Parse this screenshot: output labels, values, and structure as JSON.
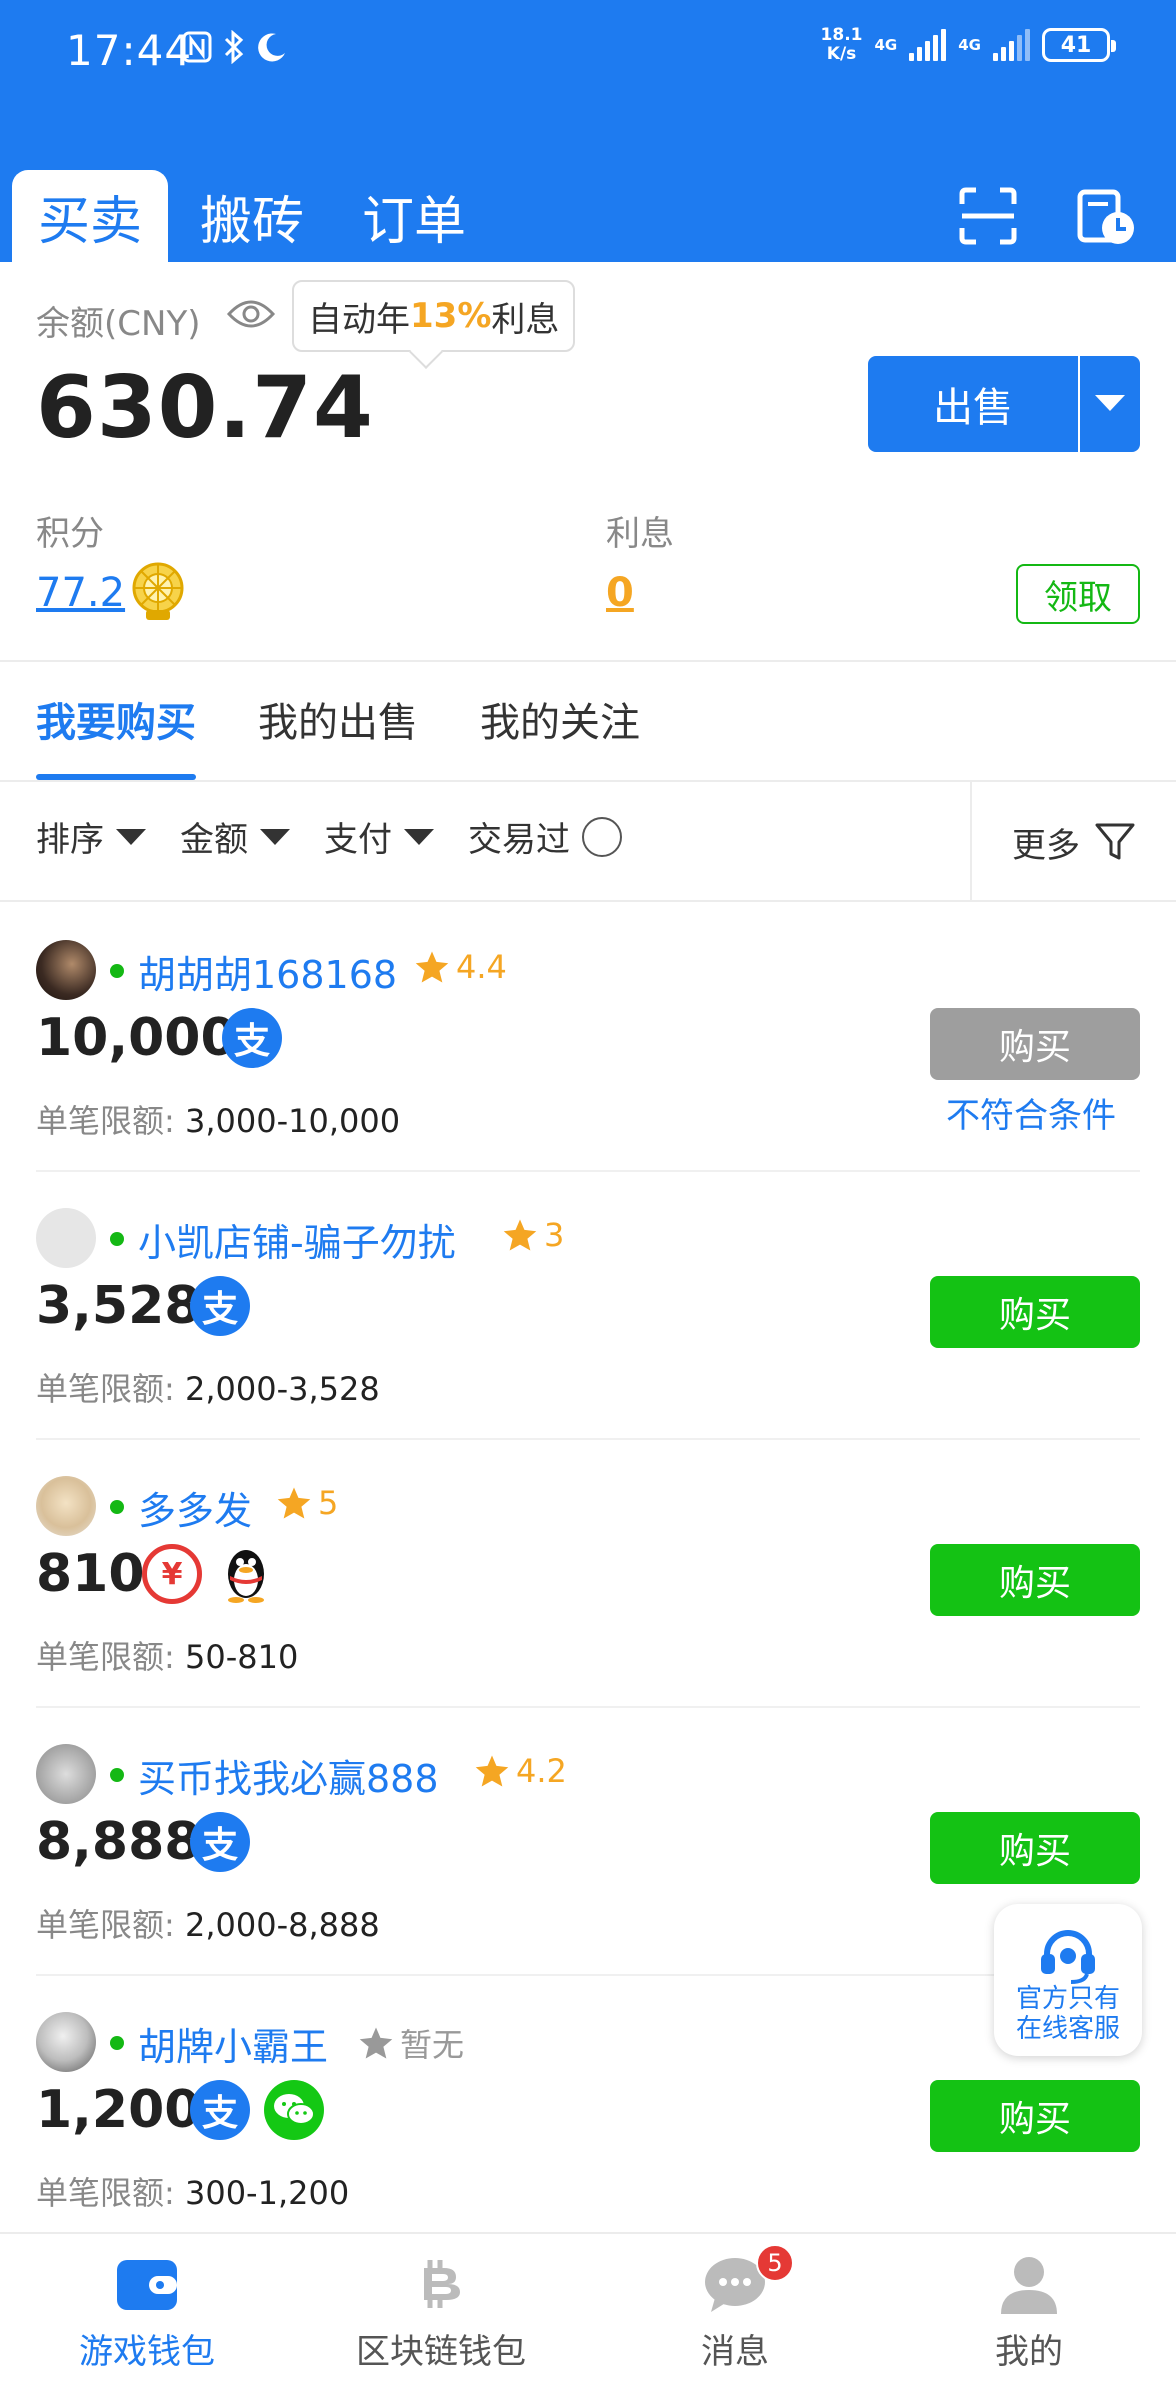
{
  "status_bar": {
    "time": "17:44",
    "net_speed_top": "18.1",
    "net_speed_bottom": "K/s",
    "signal1_label": "4G",
    "signal2_label": "4G",
    "battery": "41"
  },
  "header": {
    "tabs": [
      {
        "label": "买卖",
        "active": true
      },
      {
        "label": "搬砖",
        "active": false
      },
      {
        "label": "订单",
        "active": false
      }
    ],
    "icons": [
      "scan-icon",
      "history-icon"
    ]
  },
  "balance": {
    "label": "余额(CNY)",
    "value": "630.74",
    "promo_prefix": "自动年",
    "promo_rate": "13%",
    "promo_suffix": "利息",
    "sell_label": "出售"
  },
  "points": {
    "label": "积分",
    "value": "77.2"
  },
  "interest": {
    "label": "利息",
    "value": "0",
    "claim_label": "领取"
  },
  "sub_tabs": [
    {
      "label": "我要购买",
      "active": true
    },
    {
      "label": "我的出售",
      "active": false
    },
    {
      "label": "我的关注",
      "active": false
    }
  ],
  "filters": {
    "sort": "排序",
    "amount": "金额",
    "payment": "支付",
    "traded": "交易过",
    "more": "更多"
  },
  "listings": [
    {
      "name": "胡胡胡168168",
      "rating": "4.4",
      "amount": "10,000",
      "payments": [
        "alipay"
      ],
      "limit_label": "单笔限额:",
      "limit": "3,000-10,000",
      "buy_label": "购买",
      "eligible": false,
      "note": "不符合条件"
    },
    {
      "name": "小凯店铺-骗子勿扰",
      "rating": "3",
      "amount": "3,528",
      "payments": [
        "alipay"
      ],
      "limit_label": "单笔限额:",
      "limit": "2,000-3,528",
      "buy_label": "购买",
      "eligible": true
    },
    {
      "name": "多多发",
      "rating": "5",
      "amount": "810",
      "payments": [
        "ecny",
        "qq"
      ],
      "limit_label": "单笔限额:",
      "limit": "50-810",
      "buy_label": "购买",
      "eligible": true
    },
    {
      "name": "买币找我必赢888",
      "rating": "4.2",
      "amount": "8,888",
      "payments": [
        "alipay"
      ],
      "limit_label": "单笔限额:",
      "limit": "2,000-8,888",
      "buy_label": "购买",
      "eligible": true
    },
    {
      "name": "胡牌小霸王",
      "rating": "暂无",
      "amount": "1,200",
      "payments": [
        "alipay",
        "wechat"
      ],
      "limit_label": "单笔限额:",
      "limit": "300-1,200",
      "buy_label": "购买",
      "eligible": true
    }
  ],
  "support": {
    "line1": "官方只有",
    "line2": "在线客服"
  },
  "bottom_nav": [
    {
      "label": "游戏钱包",
      "icon": "wallet-icon",
      "active": true
    },
    {
      "label": "区块链钱包",
      "icon": "bitcoin-icon",
      "active": false
    },
    {
      "label": "消息",
      "icon": "chat-icon",
      "active": false,
      "badge": "5"
    },
    {
      "label": "我的",
      "icon": "profile-icon",
      "active": false
    }
  ],
  "colors": {
    "brand_blue": "#1e7bf0",
    "buy_green": "#14c214",
    "accent_orange": "#f5a623",
    "disabled_gray": "#9e9e9e"
  }
}
